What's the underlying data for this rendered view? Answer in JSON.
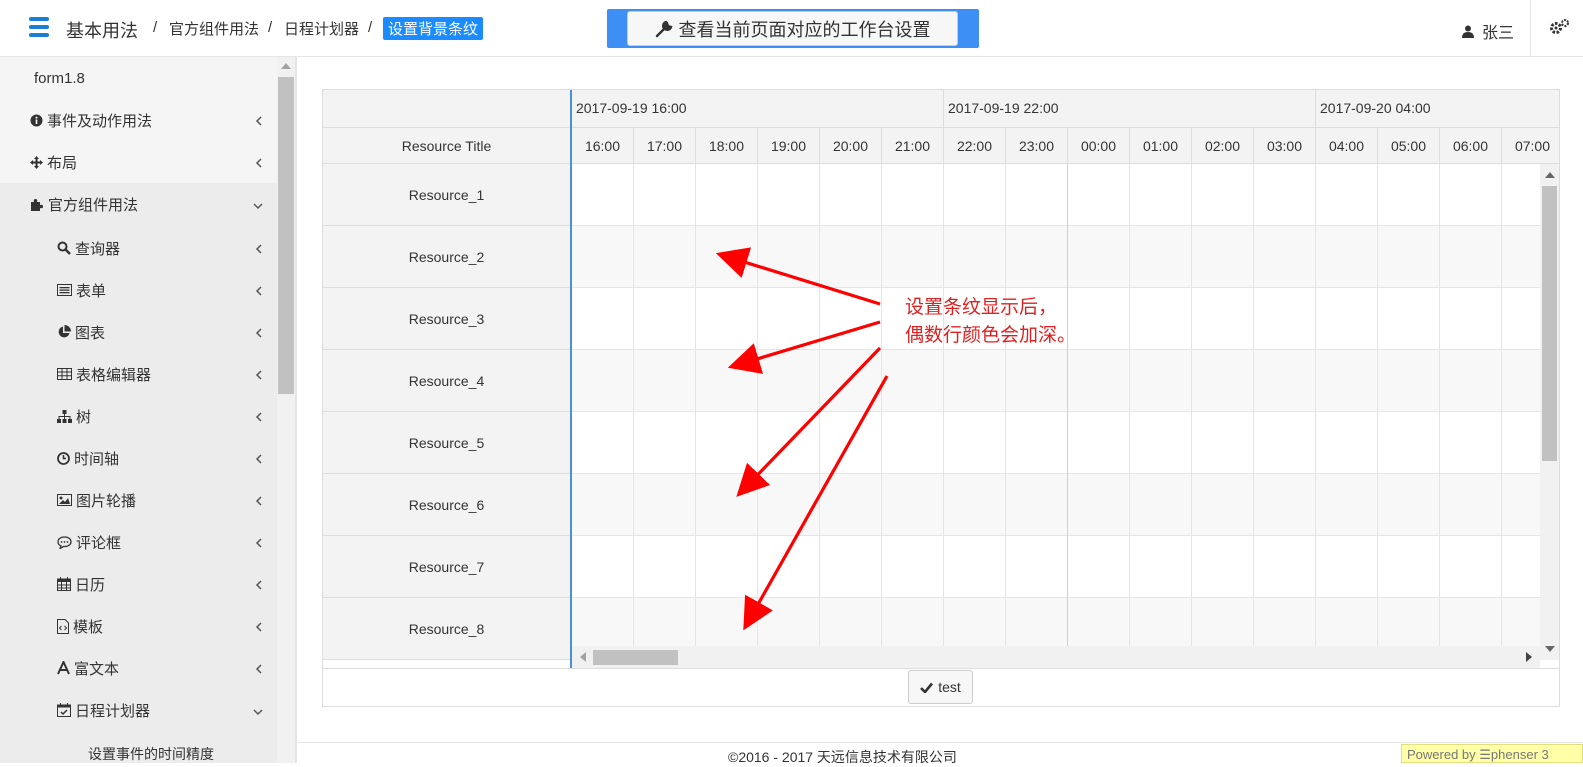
{
  "header": {
    "title": "基本用法",
    "breadcrumb": [
      "官方组件用法",
      "日程计划器",
      "设置背景条纹"
    ],
    "workspace_button": "查看当前页面对应的工作台设置",
    "user": "张三"
  },
  "sidebar": {
    "top_label": "form1.8",
    "groups": [
      {
        "label": "事件及动作用法",
        "icon": "info-circle-icon"
      },
      {
        "label": "布局",
        "icon": "arrows-move-icon"
      },
      {
        "label": "官方组件用法",
        "icon": "puzzle-icon"
      }
    ],
    "sub_items": [
      {
        "label": "查询器",
        "icon": "search-icon"
      },
      {
        "label": "表单",
        "icon": "list-alt-icon"
      },
      {
        "label": "图表",
        "icon": "pie-chart-icon"
      },
      {
        "label": "表格编辑器",
        "icon": "table-icon"
      },
      {
        "label": "树",
        "icon": "sitemap-icon"
      },
      {
        "label": "时间轴",
        "icon": "clock-icon"
      },
      {
        "label": "图片轮播",
        "icon": "image-icon"
      },
      {
        "label": "评论框",
        "icon": "comment-icon"
      },
      {
        "label": "日历",
        "icon": "calendar-icon"
      },
      {
        "label": "模板",
        "icon": "file-code-icon"
      },
      {
        "label": "富文本",
        "icon": "font-icon"
      },
      {
        "label": "日程计划器",
        "icon": "calendar-check-icon"
      }
    ],
    "partial_item": "设置事件的时间精度"
  },
  "scheduler": {
    "resource_title": "Resource Title",
    "dates": [
      "2017-09-19 16:00",
      "2017-09-19 22:00",
      "2017-09-20 04:00"
    ],
    "hours": [
      "16:00",
      "17:00",
      "18:00",
      "19:00",
      "20:00",
      "21:00",
      "22:00",
      "23:00",
      "00:00",
      "01:00",
      "02:00",
      "03:00",
      "04:00",
      "05:00",
      "06:00",
      "07:00"
    ],
    "resources": [
      "Resource_1",
      "Resource_2",
      "Resource_3",
      "Resource_4",
      "Resource_5",
      "Resource_6",
      "Resource_7",
      "Resource_8"
    ],
    "test_button": "test"
  },
  "annotation": {
    "line1": "设置条纹显示后，",
    "line2": "偶数行颜色会加深。",
    "color": "#e02020"
  },
  "footer": {
    "copyright": "©2016 - 2017 天远信息技术有限公司",
    "powered": "Powered by ☰phenser 3"
  },
  "colors": {
    "accent": "#1a8cff",
    "workspace_bg": "#3d8ff5",
    "divider": "#4a90d9"
  }
}
